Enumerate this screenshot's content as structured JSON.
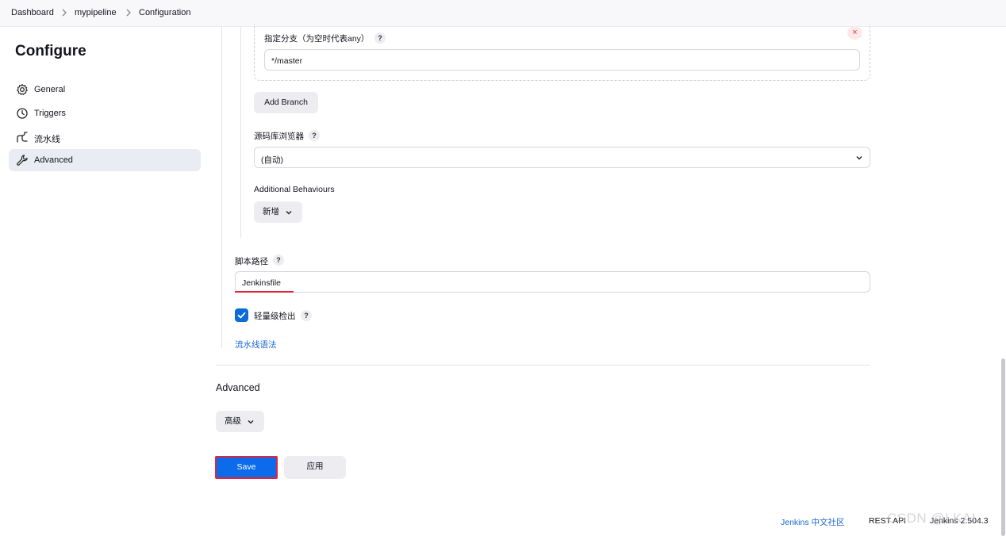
{
  "breadcrumb": [
    "Dashboard",
    "mypipeline",
    "Configuration"
  ],
  "page_title": "Configure",
  "sidebar": {
    "items": [
      {
        "label": "General",
        "icon": "gear-icon",
        "active": false
      },
      {
        "label": "Triggers",
        "icon": "clock-icon",
        "active": false
      },
      {
        "label": "流水线",
        "icon": "pipeline-icon",
        "active": false
      },
      {
        "label": "Advanced",
        "icon": "wrench-icon",
        "active": true
      }
    ]
  },
  "branch": {
    "label": "指定分支（为空时代表any）",
    "value": "*/master",
    "remove_symbol": "×",
    "add_button": "Add Branch"
  },
  "repo_browser": {
    "label": "源码库浏览器",
    "value": "(自动)"
  },
  "additional_behaviours": {
    "label": "Additional Behaviours",
    "button": "新增"
  },
  "script_path": {
    "label": "脚本路径",
    "value": "Jenkinsfile"
  },
  "lightweight_checkout": {
    "label": "轻量级检出",
    "checked": true
  },
  "pipeline_syntax_link": "流水线语法",
  "advanced": {
    "title": "Advanced",
    "button": "高级"
  },
  "actions": {
    "save": "Save",
    "apply": "应用"
  },
  "help_symbol": "?",
  "footer": {
    "community": "Jenkins 中文社区",
    "rest_api": "REST API",
    "version": "Jenkins 2.504.3"
  },
  "watermark": "CSDN @LKAI.",
  "colors": {
    "accent": "#0b6bea",
    "highlight": "#e0253a",
    "link": "#1a66d6"
  }
}
